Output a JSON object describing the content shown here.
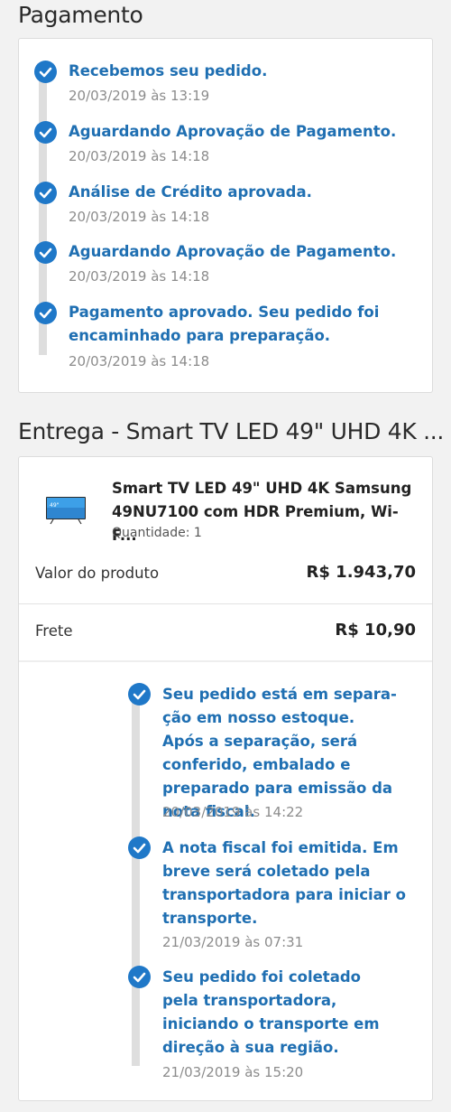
{
  "payment": {
    "title": "Pagamento",
    "events": [
      {
        "text": "Recebemos seu pedido.",
        "date": "20/03/2019 às 13:19"
      },
      {
        "text": "Aguardando Aprovação de Pagamento.",
        "date": "20/03/2019 às 14:18"
      },
      {
        "text": "Análise de Crédito aprovada.",
        "date": "20/03/2019 às 14:18"
      },
      {
        "text": "Aguardando Aprovação de Pagamento.",
        "date": "20/03/2019 às 14:18"
      },
      {
        "text": "Pagamento aprovado. Seu pedido foi encaminhado para preparação.",
        "date": "20/03/2019 às 14:18"
      }
    ]
  },
  "delivery": {
    "title": "Entrega - Smart TV LED 49\" UHD 4K ...",
    "product": {
      "name": "Smart TV LED 49\" UHD 4K Samsung 49NU7100 com HDR Premium, Wi-F...",
      "quantity": "Quantidade: 1",
      "thumb_text": "49\""
    },
    "product_value_label": "Valor do produto",
    "product_value": "R$ 1.943,70",
    "shipping_label": "Frete",
    "shipping_value": "R$ 10,90",
    "events": [
      {
        "text": "Seu pedido está em separa-ção em nosso estoque. Após a separação, será conferido, embalado e preparado para emissão da nota fiscal.",
        "date": "20/03/2019 às 14:22"
      },
      {
        "text": "A nota fiscal foi emitida. Em breve será coletado pela transportadora para iniciar o transporte.",
        "date": "21/03/2019 às 07:31"
      },
      {
        "text": "Seu pedido foi coletado pela transportadora, iniciando o transporte em direção à sua região.",
        "date": "21/03/2019 às 15:20"
      }
    ]
  },
  "colors": {
    "accent": "#1f78c8",
    "link_text": "#1f6fb2",
    "date_text": "#8c8c8c",
    "timeline_line": "#dedede",
    "background": "#f2f2f2"
  }
}
